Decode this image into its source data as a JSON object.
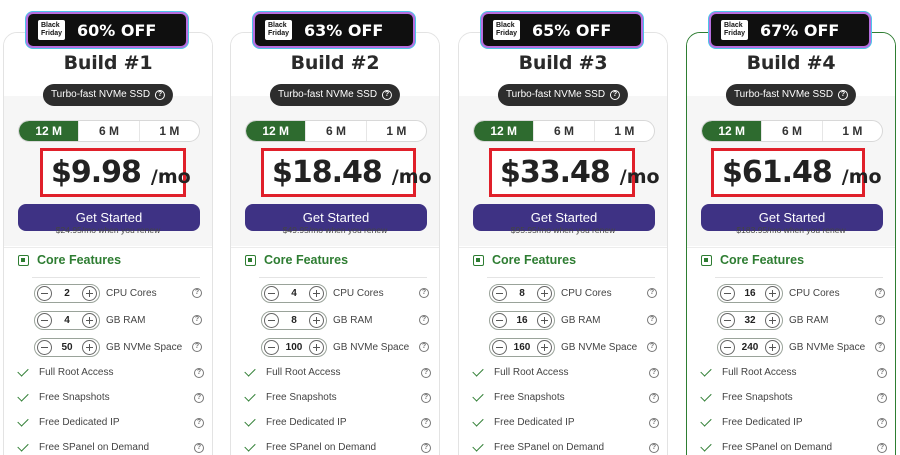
{
  "plans": [
    {
      "badge_top": "Black",
      "badge_bottom": "Friday",
      "discount": "60% OFF",
      "title": "Build #1",
      "ssd": "Turbo-fast NVMe SSD",
      "terms": [
        "12 M",
        "6 M",
        "1 M"
      ],
      "price": "$9.98",
      "per": "/mo",
      "cta": "Get Started",
      "renew": "$24.95/mo when you renew",
      "features_title": "Core Features",
      "cpu": "2",
      "ram": "4",
      "space": "50",
      "cpu_label": "CPU Cores",
      "ram_label": "GB RAM",
      "space_label": "GB NVMe Space",
      "checks": [
        "Full Root Access",
        "Free Snapshots",
        "Free Dedicated IP",
        "Free SPanel on Demand"
      ]
    },
    {
      "badge_top": "Black",
      "badge_bottom": "Friday",
      "discount": "63% OFF",
      "title": "Build #2",
      "ssd": "Turbo-fast NVMe SSD",
      "terms": [
        "12 M",
        "6 M",
        "1 M"
      ],
      "price": "$18.48",
      "per": "/mo",
      "cta": "Get Started",
      "renew": "$49.95/mo when you renew",
      "features_title": "Core Features",
      "cpu": "4",
      "ram": "8",
      "space": "100",
      "cpu_label": "CPU Cores",
      "ram_label": "GB RAM",
      "space_label": "GB NVMe Space",
      "checks": [
        "Full Root Access",
        "Free Snapshots",
        "Free Dedicated IP",
        "Free SPanel on Demand"
      ]
    },
    {
      "badge_top": "Black",
      "badge_bottom": "Friday",
      "discount": "65% OFF",
      "title": "Build #3",
      "ssd": "Turbo-fast NVMe SSD",
      "terms": [
        "12 M",
        "6 M",
        "1 M"
      ],
      "price": "$33.48",
      "per": "/mo",
      "cta": "Get Started",
      "renew": "$95.95/mo when you renew",
      "features_title": "Core Features",
      "cpu": "8",
      "ram": "16",
      "space": "160",
      "cpu_label": "CPU Cores",
      "ram_label": "GB RAM",
      "space_label": "GB NVMe Space",
      "checks": [
        "Full Root Access",
        "Free Snapshots",
        "Free Dedicated IP",
        "Free SPanel on Demand"
      ]
    },
    {
      "badge_top": "Black",
      "badge_bottom": "Friday",
      "discount": "67% OFF",
      "title": "Build #4",
      "ssd": "Turbo-fast NVMe SSD",
      "terms": [
        "12 M",
        "6 M",
        "1 M"
      ],
      "price": "$61.48",
      "per": "/mo",
      "cta": "Get Started",
      "renew": "$183.95/mo when you renew",
      "features_title": "Core Features",
      "cpu": "16",
      "ram": "32",
      "space": "240",
      "cpu_label": "CPU Cores",
      "ram_label": "GB RAM",
      "space_label": "GB NVMe Space",
      "checks": [
        "Full Root Access",
        "Free Snapshots",
        "Free Dedicated IP",
        "Free SPanel on Demand"
      ]
    }
  ],
  "colors": {
    "accent_green": "#2e7d32",
    "cta_purple": "#3e3284",
    "highlight_red": "#e0202a"
  },
  "icons": {
    "help": "question-circle-icon",
    "check": "check-icon",
    "chip": "cpu-chip-icon"
  }
}
